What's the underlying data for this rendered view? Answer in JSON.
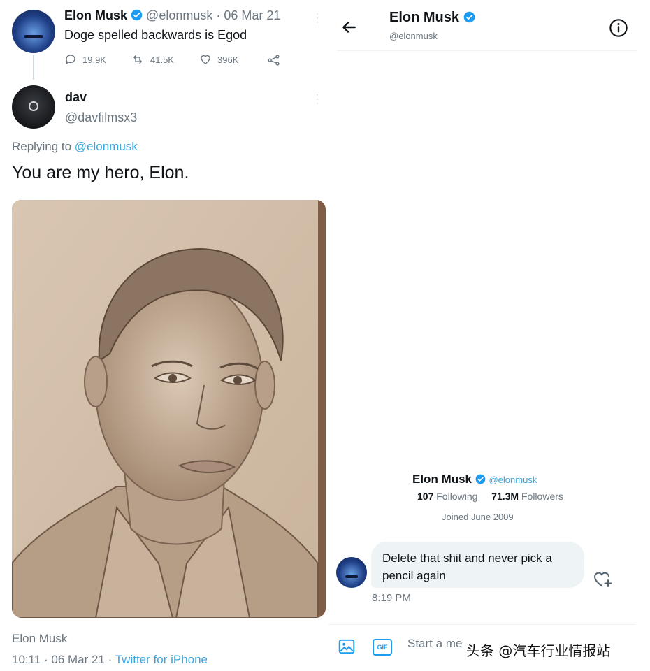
{
  "left_panel": {
    "parent_tweet": {
      "author_name": "Elon Musk",
      "handle_date": "@elonmusk · 06 Mar 21",
      "text": "Doge spelled backwards is Egod",
      "actions": {
        "replies": "19.9K",
        "retweets": "41.5K",
        "likes": "396K"
      }
    },
    "reply_tweet": {
      "author_name": "dav",
      "handle": "@davfilmsx3",
      "replying_to_label": "Replying to ",
      "replying_to_handle": "@elonmusk",
      "text": "You are my hero, Elon.",
      "meta_author": "Elon Musk",
      "meta_time": "10:11 · 06 Mar 21 · ",
      "meta_source": "Twitter for iPhone"
    }
  },
  "right_panel": {
    "header": {
      "name": "Elon Musk",
      "handle": "@elonmusk"
    },
    "profile_card": {
      "name": "Elon Musk",
      "handle": "@elonmusk",
      "following_count": "107",
      "following_label": "Following",
      "followers_count": "71.3M",
      "followers_label": "Followers",
      "joined": "Joined June 2009"
    },
    "message": {
      "text": "Delete that shit and never pick a pencil again",
      "time": "8:19 PM"
    },
    "composer": {
      "placeholder": "Start a me",
      "gif_label": "GIF"
    }
  },
  "watermark": {
    "text": "头条 @汽车行业情报站"
  },
  "colors": {
    "accent": "#1d9bf0",
    "link": "#3aa6e0",
    "muted": "#6b7680",
    "bubble": "#eef3f6"
  }
}
